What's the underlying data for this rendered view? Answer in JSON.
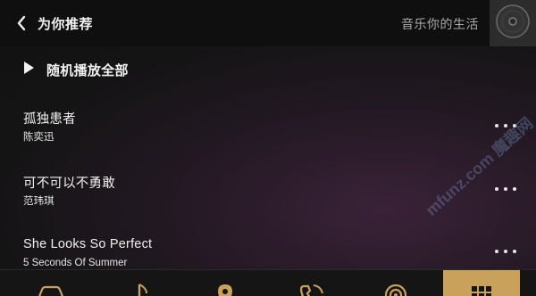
{
  "header": {
    "title": "为你推荐",
    "slogan": "音乐你的生活",
    "back_icon": "chevron-left-icon",
    "disc_icon": "disc-icon"
  },
  "shuffle": {
    "label": "随机播放全部",
    "icon": "play-icon"
  },
  "songs": [
    {
      "title": "孤独患者",
      "artist": "陈奕迅"
    },
    {
      "title": "可不可以不勇敢",
      "artist": "范玮琪"
    },
    {
      "title": "She Looks So Perfect",
      "artist": "5 Seconds Of Summer"
    }
  ],
  "more_icon": "more-dots-icon",
  "watermark": {
    "text": "mfunz.com 魔趣网"
  },
  "bottom_nav": {
    "items": [
      {
        "icon": "car-icon",
        "active": false
      },
      {
        "icon": "music-note-icon",
        "active": false
      },
      {
        "icon": "location-pin-icon",
        "active": false
      },
      {
        "icon": "phone-icon",
        "active": false
      },
      {
        "icon": "radio-icon",
        "active": false
      },
      {
        "icon": "apps-grid-icon",
        "active": true
      }
    ]
  },
  "colors": {
    "accent": "#c9a15a",
    "background": "#141414",
    "header_background": "#0f0f0f",
    "text_primary": "#f2f2f2",
    "text_secondary": "#a8a8a8"
  }
}
